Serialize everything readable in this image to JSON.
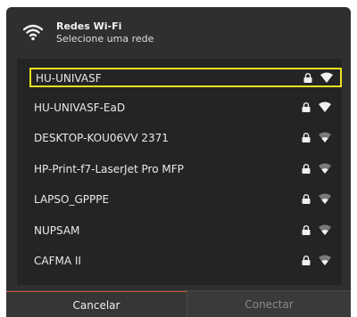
{
  "header": {
    "title": "Redes Wi-Fi",
    "subtitle": "Selecione uma rede",
    "icon": "wifi-icon"
  },
  "networks": [
    {
      "name": "HU-UNIVASF",
      "secured": true,
      "signal": "strong",
      "selected": true
    },
    {
      "name": "HU-UNIVASF-EaD",
      "secured": true,
      "signal": "strong",
      "selected": false
    },
    {
      "name": "DESKTOP-KOU06VV 2371",
      "secured": true,
      "signal": "weak",
      "selected": false
    },
    {
      "name": "HP-Print-f7-LaserJet Pro MFP",
      "secured": true,
      "signal": "weak",
      "selected": false
    },
    {
      "name": "LAPSO_GPPPE",
      "secured": true,
      "signal": "weak",
      "selected": false
    },
    {
      "name": "NUPSAM",
      "secured": true,
      "signal": "weak",
      "selected": false
    },
    {
      "name": "CAFMA II",
      "secured": true,
      "signal": "weak",
      "selected": false
    }
  ],
  "footer": {
    "cancel_label": "Cancelar",
    "connect_label": "Conectar"
  },
  "colors": {
    "selection_border": "#f0e020",
    "dialog_bg": "#2f2f2f",
    "list_bg": "#242424"
  }
}
